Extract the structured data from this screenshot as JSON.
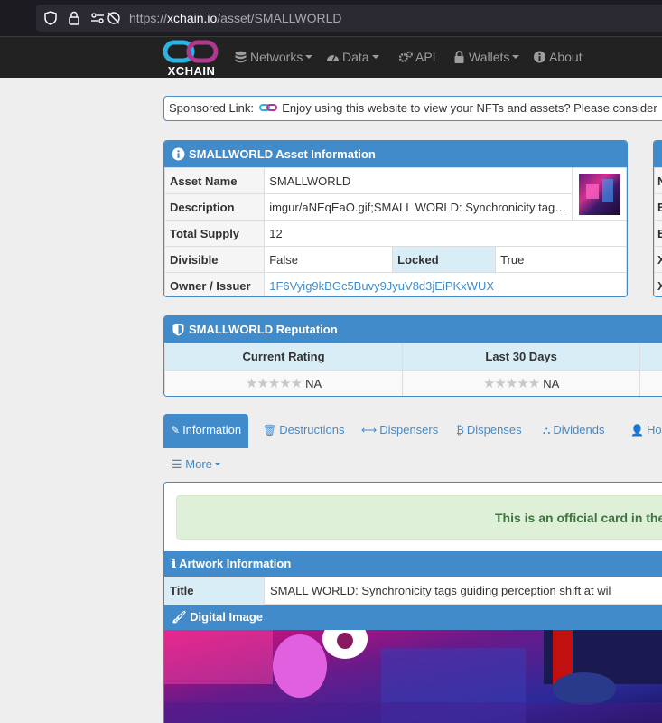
{
  "browser": {
    "url_prefix": "https://",
    "url_host": "xchain.io",
    "url_path": "/asset/SMALLWORLD"
  },
  "navbar": {
    "logo_text": "XCHAIN",
    "items": [
      {
        "label": "Networks",
        "icon": "database-icon"
      },
      {
        "label": "Data",
        "icon": "dashboard-icon"
      },
      {
        "label": "API",
        "icon": "gears-icon"
      },
      {
        "label": "Wallets",
        "icon": "lock-icon"
      },
      {
        "label": "About",
        "icon": "info-icon"
      }
    ]
  },
  "sponsor": {
    "label": "Sponsored Link:",
    "text": "Enjoy using this website to view your NFTs and assets? Please consider"
  },
  "asset_info": {
    "title": "SMALLWORLD Asset Information",
    "rows": {
      "asset_name_label": "Asset Name",
      "asset_name": "SMALLWORLD",
      "description_label": "Description",
      "description": "imgur/aNEqEaO.gif;SMALL WORLD: Synchronicity tag…",
      "total_supply_label": "Total Supply",
      "total_supply": "12",
      "divisible_label": "Divisible",
      "divisible": "False",
      "locked_label": "Locked",
      "locked": "True",
      "owner_label": "Owner / Issuer",
      "owner": "1F6Vyig9kBGc5Buvy9JyuV8d3jEiPKxWUX"
    }
  },
  "side_panel": {
    "row_initials": [
      "N",
      "E",
      "E",
      "X",
      "X"
    ]
  },
  "reputation": {
    "title": "SMALLWORLD Reputation",
    "col1": "Current Rating",
    "col2": "Last 30 Days",
    "rating1": "NA",
    "rating2": "NA",
    "stars": "★★★★★"
  },
  "tabs": [
    {
      "label": "Information",
      "icon": "file-icon",
      "active": true
    },
    {
      "label": "Destructions",
      "icon": "trash-icon"
    },
    {
      "label": "Dispensers",
      "icon": "arrows-h-icon"
    },
    {
      "label": "Dispenses",
      "icon": "bitcoin-icon"
    },
    {
      "label": "Dividends",
      "icon": "sitemap-icon"
    },
    {
      "label": "Hol",
      "icon": "user-icon"
    }
  ],
  "more_label": "More",
  "official_card": "This is an official card in the",
  "artwork": {
    "title": "Artwork Information",
    "title_label": "Title",
    "title_value": "SMALL WORLD: Synchronicity tags guiding perception shift at wil"
  },
  "digital_image": {
    "title": "Digital Image"
  },
  "colors": {
    "primary": "#428bca",
    "navbar": "#222222",
    "success_bg": "#dff0d8",
    "success_text": "#3c763d"
  }
}
